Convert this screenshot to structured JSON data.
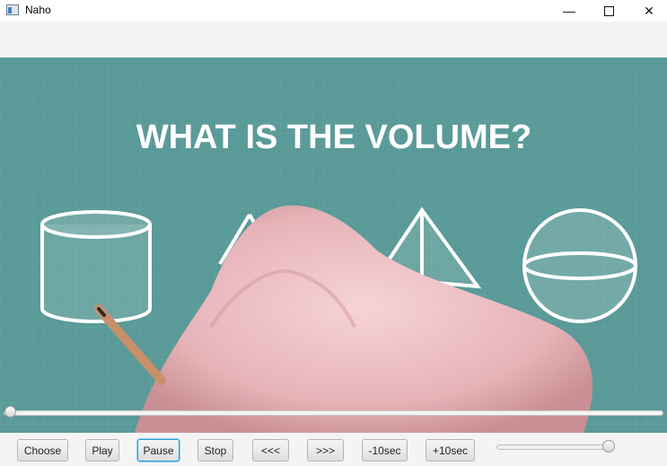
{
  "window": {
    "title": "Naho",
    "minimize_icon": "minimize-icon",
    "maximize_icon": "maximize-icon",
    "close_icon": "close-icon"
  },
  "video": {
    "headline": "WHAT IS THE VOLUME?",
    "background_color": "#5a9a98"
  },
  "seek": {
    "position": 0.0
  },
  "controls": {
    "buttons": [
      "Choose",
      "Play",
      "Pause",
      "Stop",
      "<<<",
      ">>>",
      "-10sec",
      "+10sec"
    ],
    "focused": "Pause"
  },
  "volume": {
    "level": 0.95
  }
}
